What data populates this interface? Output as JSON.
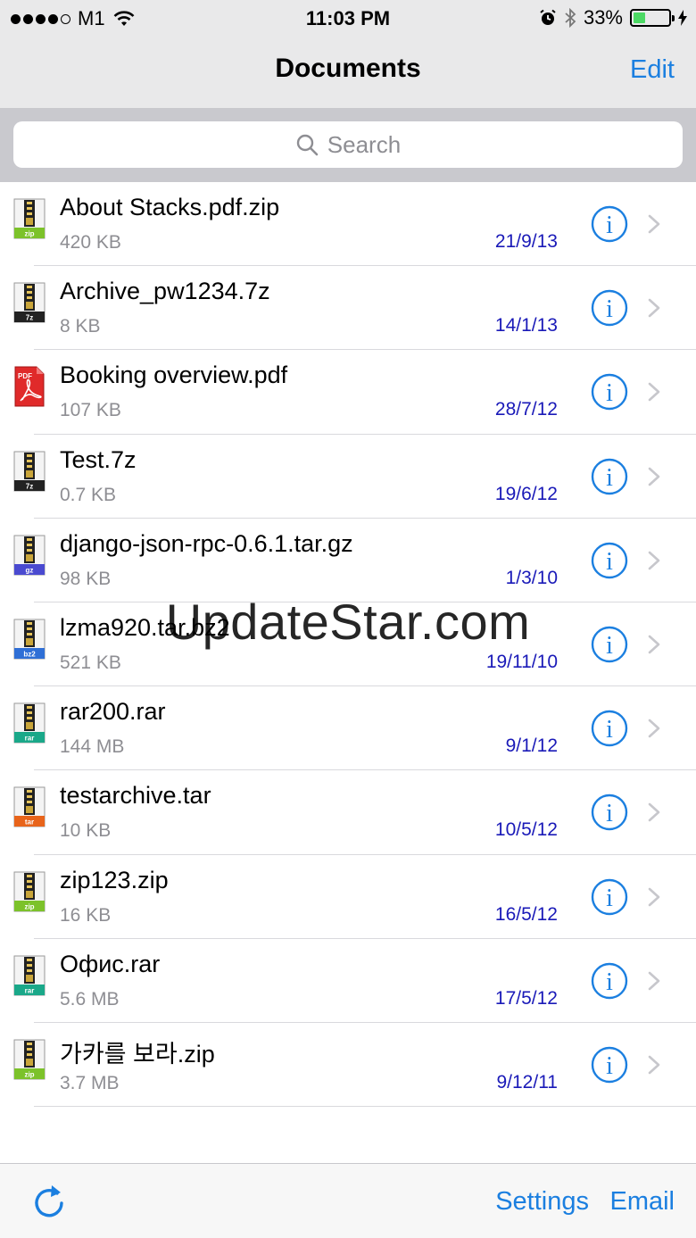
{
  "status_bar": {
    "carrier": "M1",
    "time": "11:03 PM",
    "battery_percent": "33%",
    "battery_level": 0.33,
    "icons": [
      "signal-dots-icon",
      "wifi-icon",
      "alarm-icon",
      "bluetooth-icon",
      "battery-icon",
      "charging-icon"
    ]
  },
  "nav": {
    "title": "Documents",
    "edit_label": "Edit"
  },
  "search": {
    "placeholder": "Search"
  },
  "files": [
    {
      "name": "About Stacks.pdf.zip",
      "size": "420 KB",
      "date": "21/9/13",
      "type": "zip"
    },
    {
      "name": "Archive_pw1234.7z",
      "size": "8 KB",
      "date": "14/1/13",
      "type": "7z"
    },
    {
      "name": "Booking overview.pdf",
      "size": "107 KB",
      "date": "28/7/12",
      "type": "pdf"
    },
    {
      "name": "Test.7z",
      "size": "0.7 KB",
      "date": "19/6/12",
      "type": "7z"
    },
    {
      "name": "django-json-rpc-0.6.1.tar.gz",
      "size": "98 KB",
      "date": "1/3/10",
      "type": "gz"
    },
    {
      "name": "lzma920.tar.bz2",
      "size": "521 KB",
      "date": "19/11/10",
      "type": "bz2"
    },
    {
      "name": "rar200.rar",
      "size": "144 MB",
      "date": "9/1/12",
      "type": "rar"
    },
    {
      "name": "testarchive.tar",
      "size": "10 KB",
      "date": "10/5/12",
      "type": "tar"
    },
    {
      "name": "zip123.zip",
      "size": "16 KB",
      "date": "16/5/12",
      "type": "zip"
    },
    {
      "name": "Офис.rar",
      "size": "5.6 MB",
      "date": "17/5/12",
      "type": "rar"
    },
    {
      "name": "가카를 보라.zip",
      "size": "3.7 MB",
      "date": "9/12/11",
      "type": "zip"
    }
  ],
  "type_colors": {
    "zip": "#7cc22a",
    "7z": "#222222",
    "gz": "#4a4ad0",
    "bz2": "#2f6fd6",
    "rar": "#1aa889",
    "tar": "#e8641b",
    "pdf": "#d81e1e"
  },
  "watermark": "UpdateStar.com",
  "toolbar": {
    "settings_label": "Settings",
    "email_label": "Email"
  },
  "colors": {
    "accent": "#1b7fe0",
    "date": "#1a1ab8"
  }
}
